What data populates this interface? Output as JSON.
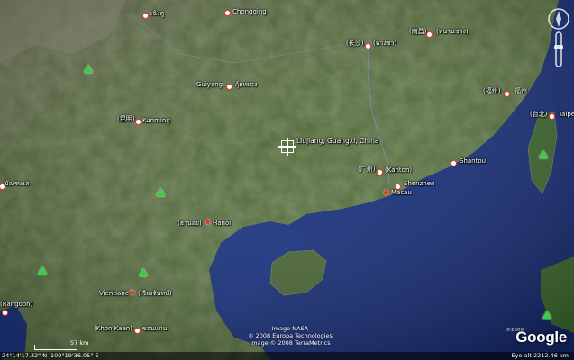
{
  "colors": {
    "pin": "#e33333",
    "peak": "#2fd43a",
    "sea": "#1a2f78",
    "land": "#4b5f35"
  },
  "places": {
    "chongqing": "Chongqing",
    "kunming_local": "(昆明)",
    "kunming": "Kunming",
    "guiyang": "Guiyang",
    "guiyang_thai": "กุ้ยหยาง",
    "changsha_local": "(长沙)",
    "changsha_thai": "(ฉางชา)",
    "nanchang_local": "(南昌)",
    "nanchang_thai": "(หนานชาง)",
    "fuzhou_local": "(福州)",
    "fuzhou_tail": "福州",
    "taipei_local": "(台北)",
    "taipei": "Taipei",
    "chengdu_thai": "เฉิงตู",
    "liujiang": "Liujiang, Guangxi, China",
    "guangzhou_local": "(广州)",
    "kanton": "(Kanton)",
    "shantou": "Shantou",
    "shenzhen": "Shenzhen",
    "macau": "Macau",
    "hanoi_thai": "(ฮานอย)",
    "hanoi": "Hanoi",
    "vientiane": "Vientiane",
    "vientiane_thai": "(เวียงจันทน์)",
    "rangoon": "(Rangoon)",
    "khonkaen": "(Khon Kaen)",
    "khonkaen_thai": "ขอนแก่น",
    "mandalay_thai": "มัณฑะเล"
  },
  "credits": {
    "nasa": "Image NASA",
    "europa": "© 2008 Europa Technologies",
    "terrametrics": "Image © 2008 TerraMetrics"
  },
  "status": {
    "latitude": "24°14'17.32\" N",
    "longitude": "109°19'36.05\" E",
    "scale": "57 km",
    "year": "©2008",
    "eye_alt": "Eye alt  2212.46 km"
  },
  "logo": "Google"
}
